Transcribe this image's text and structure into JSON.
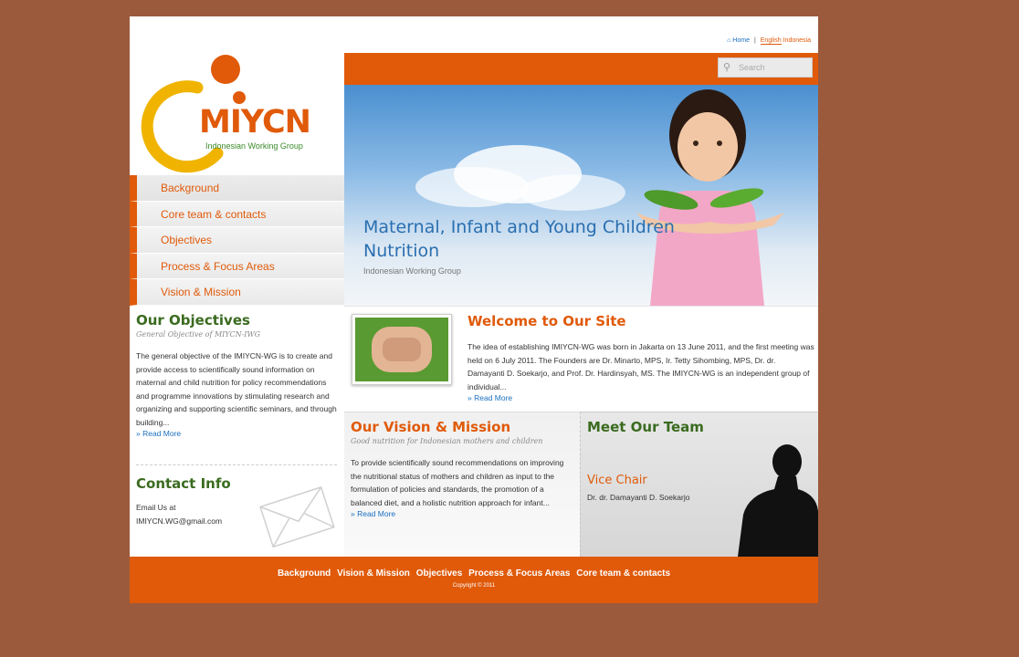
{
  "logo": {
    "text": "MIYCN",
    "sub": "Indonesian Working Group",
    "colors": {
      "orange": "#e05a0a",
      "yellow": "#f0b400",
      "green": "#3a8a2a"
    }
  },
  "header": {
    "links": {
      "home": "Home",
      "separator": "|",
      "lang_english": "English",
      "lang_indonesia": "Indonesia"
    },
    "search_placeholder": "Search"
  },
  "nav": [
    {
      "label": "Background"
    },
    {
      "label": "Core team & contacts"
    },
    {
      "label": "Objectives"
    },
    {
      "label": "Process & Focus Areas"
    },
    {
      "label": "Vision & Mission"
    }
  ],
  "hero": {
    "title_line1": "Maternal, Infant and Young Children",
    "title_line2": "Nutrition",
    "subtitle": "Indonesian Working Group"
  },
  "objectives": {
    "title": "Our Objectives",
    "subtitle": "General Objective of MIYCN-IWG",
    "body": "The general objective of the IMIYCN-WG is to create and provide access to scientifically sound information on maternal and child nutrition for policy recommendations and programme innovations by stimulating research and organizing and supporting scientific seminars, and through building...",
    "more": "» Read More"
  },
  "contact": {
    "title": "Contact Info",
    "line1": "Email Us at",
    "line2": "IMIYCN.WG@gmail.com"
  },
  "welcome": {
    "title": "Welcome to Our Site",
    "body": "The idea of establishing IMIYCN-WG was born in Jakarta on 13 June 2011, and the first meeting was held on 6 July 2011. The Founders are Dr. Minarto, MPS, Ir. Tetty Sihombing, MPS, Dr. dr. Damayanti D. Soekarjo, and Prof. Dr. Hardinsyah, MS. The IMIYCN-WG is an independent group of individual...",
    "more": "» Read More"
  },
  "vision": {
    "title": "Our Vision & Mission",
    "subtitle": "Good nutrition for Indonesian mothers and children",
    "body": "To provide scientifically sound recommendations on improving the nutritional status of mothers and children as input to the formulation of policies and standards, the promotion of a balanced diet, and a holistic nutrition approach for infant...",
    "more": "» Read More"
  },
  "team": {
    "title": "Meet Our Team",
    "role": "Vice Chair",
    "name": "Dr. dr. Damayanti D. Soekarjo"
  },
  "footer": {
    "links": [
      "Background",
      "Vision & Mission",
      "Objectives",
      "Process & Focus Areas",
      "Core team & contacts"
    ],
    "copyright": "Copyright © 2011"
  }
}
